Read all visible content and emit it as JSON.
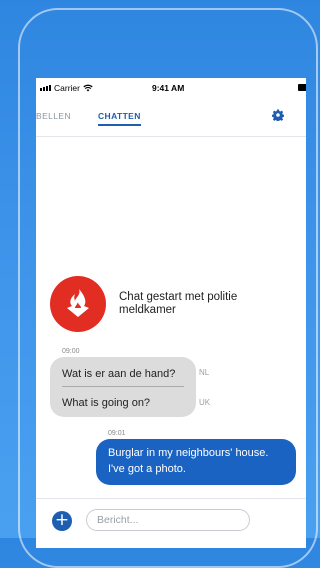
{
  "status_bar": {
    "carrier": "Carrier",
    "time": "9:41 AM"
  },
  "tabs": [
    {
      "label": "BELLEN",
      "active": false
    },
    {
      "label": "CHATTEN",
      "active": true
    }
  ],
  "chat": {
    "started_text": "Chat gestart met politie meldkamer",
    "messages": [
      {
        "time": "09:00",
        "direction": "incoming",
        "original": "Wat is er aan de hand?",
        "original_lang": "NL",
        "translation": "What is going on?",
        "translation_lang": "UK"
      },
      {
        "time": "09:01",
        "direction": "outgoing",
        "text": "Burglar in my neighbours' house. I've got a photo."
      }
    ]
  },
  "composer": {
    "placeholder": "Bericht..."
  },
  "colors": {
    "primary": "#1d5eb0",
    "outgoing_bubble": "#1b63c3",
    "logo_red": "#e12d22",
    "incoming_bubble": "#dcdcdc"
  },
  "icons": {
    "add": "plus-icon",
    "settings": "gear-icon",
    "logo": "police-flame-logo"
  }
}
